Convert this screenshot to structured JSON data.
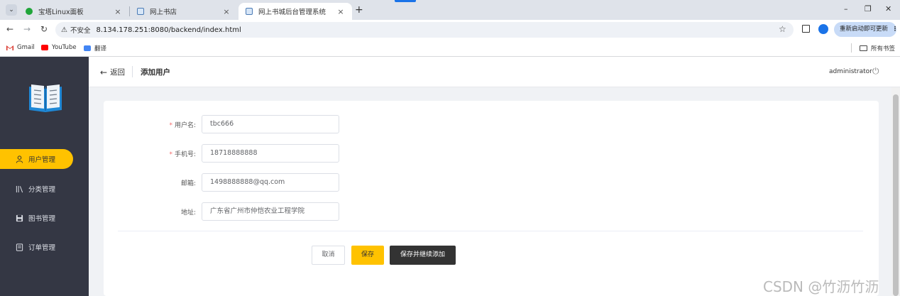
{
  "browser": {
    "tabs": [
      {
        "title": "宝塔Linux面板",
        "active": false
      },
      {
        "title": "网上书店",
        "active": false
      },
      {
        "title": "网上书城后台管理系统",
        "active": true
      }
    ],
    "tab_close": "×",
    "new_tab": "+",
    "window_controls": {
      "minimize": "–",
      "maximize": "❐",
      "close": "✕"
    },
    "security_label": "不安全",
    "url": "8.134.178.251:8080/backend/index.html",
    "update_button": "重新启动即可更新",
    "bookmarks": [
      "Gmail",
      "YouTube",
      "翻译"
    ],
    "all_bookmarks": "所有书签"
  },
  "sidebar": {
    "logo_icon": "open-book-icon",
    "items": [
      {
        "label": "用户管理",
        "icon": "user-icon",
        "active": true
      },
      {
        "label": "分类管理",
        "icon": "library-icon",
        "active": false
      },
      {
        "label": "图书管理",
        "icon": "save-icon",
        "active": false
      },
      {
        "label": "订单管理",
        "icon": "document-icon",
        "active": false
      }
    ],
    "active_color": "#ffc200",
    "background": "#343744"
  },
  "header": {
    "back_label": "返回",
    "title": "添加用户",
    "username": "administrator"
  },
  "form": {
    "fields": [
      {
        "label": "用户名:",
        "required": true,
        "value": "tbc666"
      },
      {
        "label": "手机号:",
        "required": true,
        "value": "18718888888"
      },
      {
        "label": "邮箱:",
        "required": false,
        "value": "1498888888@qq.com"
      },
      {
        "label": "地址:",
        "required": false,
        "value": "广东省广州市仲恺农业工程学院"
      }
    ],
    "buttons": {
      "cancel": "取消",
      "save": "保存",
      "save_continue": "保存并继续添加"
    }
  },
  "watermark": "CSDN @竹沥竹沥"
}
